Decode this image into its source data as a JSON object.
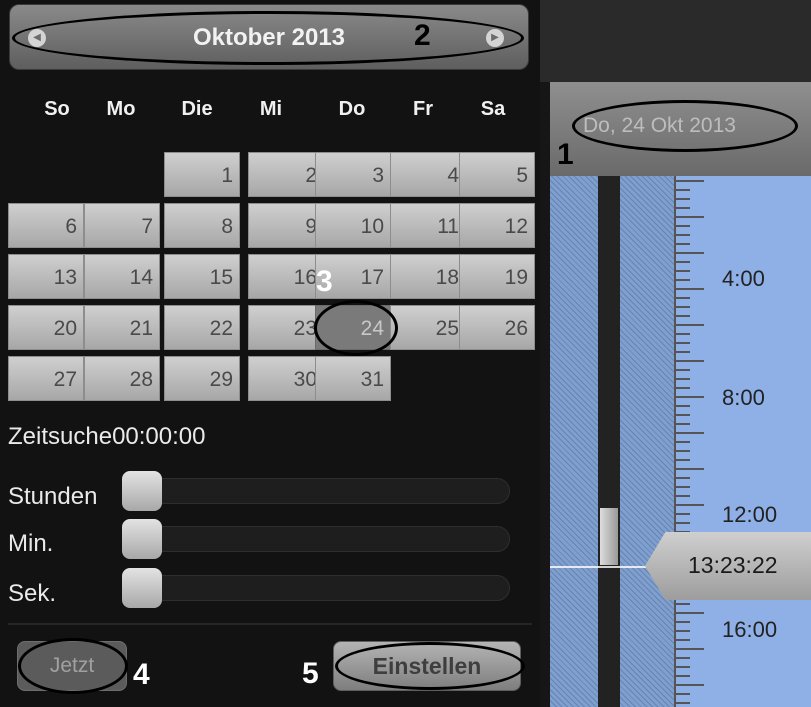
{
  "calendar": {
    "month_title": "Oktober 2013",
    "prev_icon": "chevron-left-icon",
    "next_icon": "chevron-right-icon",
    "weekdays": [
      "So",
      "Mo",
      "Die",
      "Mi",
      "Do",
      "Fr",
      "Sa"
    ],
    "days": [
      "1",
      "2",
      "3",
      "4",
      "5",
      "6",
      "7",
      "8",
      "9",
      "10",
      "11",
      "12",
      "13",
      "14",
      "15",
      "16",
      "17",
      "18",
      "19",
      "20",
      "21",
      "22",
      "23",
      "24",
      "25",
      "26",
      "27",
      "28",
      "29",
      "30",
      "31"
    ],
    "selected_day": "24"
  },
  "time_search": {
    "label": "Zeitsuche",
    "value": "00:00:00",
    "sliders": [
      {
        "label": "Stunden",
        "value": 0
      },
      {
        "label": "Min.",
        "value": 0
      },
      {
        "label": "Sek.",
        "value": 0
      }
    ]
  },
  "buttons": {
    "now": "Jetzt",
    "apply": "Einstellen"
  },
  "timeline": {
    "date": "Do, 24 Okt 2013",
    "hours": [
      "4:00",
      "8:00",
      "12:00",
      "16:00"
    ],
    "current_time": "13:23:22"
  },
  "annotations": [
    "1",
    "2",
    "3",
    "4",
    "5"
  ],
  "colors": {
    "timeline_bg": "#8fb0e6",
    "panel_bg": "#121212"
  }
}
